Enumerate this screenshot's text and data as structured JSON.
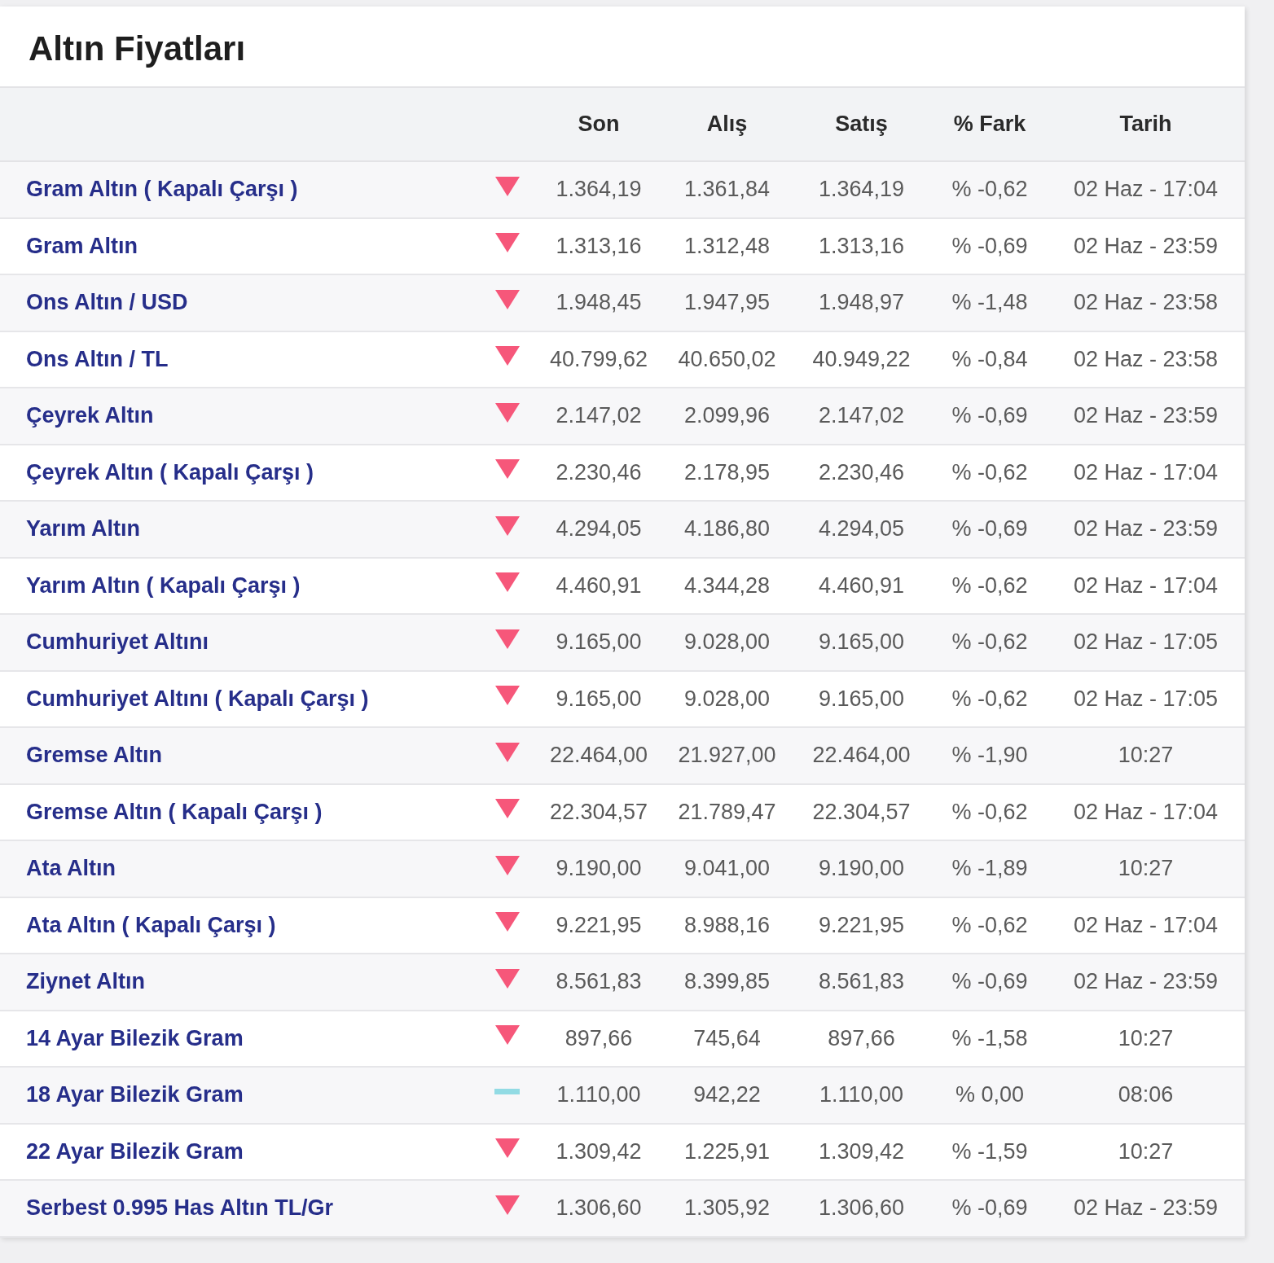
{
  "title": "Altın Fiyatları",
  "columns": [
    "Son",
    "Alış",
    "Satış",
    "% Fark",
    "Tarih"
  ],
  "rows": [
    {
      "name": "Gram Altın ( Kapalı Çarşı )",
      "falling": true,
      "son": "1.364,19",
      "alis": "1.361,84",
      "satis": "1.364,19",
      "fark": "% -0,62",
      "tarih": "02 Haz - 17:04"
    },
    {
      "name": "Gram Altın",
      "falling": true,
      "son": "1.313,16",
      "alis": "1.312,48",
      "satis": "1.313,16",
      "fark": "% -0,69",
      "tarih": "02 Haz - 23:59"
    },
    {
      "name": "Ons Altın / USD",
      "falling": true,
      "son": "1.948,45",
      "alis": "1.947,95",
      "satis": "1.948,97",
      "fark": "% -1,48",
      "tarih": "02 Haz - 23:58"
    },
    {
      "name": "Ons Altın / TL",
      "falling": true,
      "son": "40.799,62",
      "alis": "40.650,02",
      "satis": "40.949,22",
      "fark": "% -0,84",
      "tarih": "02 Haz - 23:58"
    },
    {
      "name": "Çeyrek Altın",
      "falling": true,
      "son": "2.147,02",
      "alis": "2.099,96",
      "satis": "2.147,02",
      "fark": "% -0,69",
      "tarih": "02 Haz - 23:59"
    },
    {
      "name": "Çeyrek Altın ( Kapalı Çarşı )",
      "falling": true,
      "son": "2.230,46",
      "alis": "2.178,95",
      "satis": "2.230,46",
      "fark": "% -0,62",
      "tarih": "02 Haz - 17:04"
    },
    {
      "name": "Yarım Altın",
      "falling": true,
      "son": "4.294,05",
      "alis": "4.186,80",
      "satis": "4.294,05",
      "fark": "% -0,69",
      "tarih": "02 Haz - 23:59"
    },
    {
      "name": "Yarım Altın ( Kapalı Çarşı )",
      "falling": true,
      "son": "4.460,91",
      "alis": "4.344,28",
      "satis": "4.460,91",
      "fark": "% -0,62",
      "tarih": "02 Haz - 17:04"
    },
    {
      "name": "Cumhuriyet Altını",
      "falling": true,
      "son": "9.165,00",
      "alis": "9.028,00",
      "satis": "9.165,00",
      "fark": "% -0,62",
      "tarih": "02 Haz - 17:05"
    },
    {
      "name": "Cumhuriyet Altını ( Kapalı Çarşı )",
      "falling": true,
      "son": "9.165,00",
      "alis": "9.028,00",
      "satis": "9.165,00",
      "fark": "% -0,62",
      "tarih": "02 Haz - 17:05"
    },
    {
      "name": "Gremse Altın",
      "falling": true,
      "son": "22.464,00",
      "alis": "21.927,00",
      "satis": "22.464,00",
      "fark": "% -1,90",
      "tarih": "10:27"
    },
    {
      "name": "Gremse Altın ( Kapalı Çarşı )",
      "falling": true,
      "son": "22.304,57",
      "alis": "21.789,47",
      "satis": "22.304,57",
      "fark": "% -0,62",
      "tarih": "02 Haz - 17:04"
    },
    {
      "name": "Ata Altın",
      "falling": true,
      "son": "9.190,00",
      "alis": "9.041,00",
      "satis": "9.190,00",
      "fark": "% -1,89",
      "tarih": "10:27"
    },
    {
      "name": "Ata Altın ( Kapalı Çarşı )",
      "falling": true,
      "son": "9.221,95",
      "alis": "8.988,16",
      "satis": "9.221,95",
      "fark": "% -0,62",
      "tarih": "02 Haz - 17:04"
    },
    {
      "name": "Ziynet Altın",
      "falling": true,
      "son": "8.561,83",
      "alis": "8.399,85",
      "satis": "8.561,83",
      "fark": "% -0,69",
      "tarih": "02 Haz - 23:59"
    },
    {
      "name": "14 Ayar Bilezik Gram",
      "falling": true,
      "son": "897,66",
      "alis": "745,64",
      "satis": "897,66",
      "fark": "% -1,58",
      "tarih": "10:27"
    },
    {
      "name": "18 Ayar Bilezik Gram",
      "falling": false,
      "son": "1.110,00",
      "alis": "942,22",
      "satis": "1.110,00",
      "fark": "% 0,00",
      "tarih": "08:06"
    },
    {
      "name": "22 Ayar Bilezik Gram",
      "falling": true,
      "son": "1.309,42",
      "alis": "1.225,91",
      "satis": "1.309,42",
      "fark": "% -1,59",
      "tarih": "10:27"
    },
    {
      "name": "Serbest 0.995 Has Altın TL/Gr",
      "falling": true,
      "son": "1.306,60",
      "alis": "1.305,92",
      "satis": "1.306,60",
      "fark": "% -0,69",
      "tarih": "02 Haz - 23:59"
    }
  ]
}
